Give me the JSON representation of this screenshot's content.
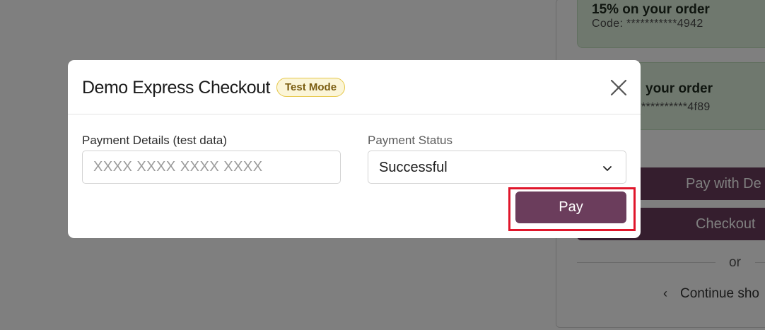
{
  "background": {
    "promo_1": {
      "title": "15% on your order",
      "code": "Code: ***********4942"
    },
    "promo_2": {
      "title": "your order",
      "code": "**********4f89"
    },
    "pay_button_label": "Pay with De",
    "checkout_button_label": "Checkout",
    "divider_text": "or",
    "continue_label": "Continue sho",
    "continue_icon": "chevron-left-icon"
  },
  "modal": {
    "title": "Demo Express Checkout",
    "badge": "Test Mode",
    "close_icon": "close-icon",
    "payment_details": {
      "label": "Payment Details (test data)",
      "placeholder": "XXXX XXXX XXXX XXXX",
      "value": ""
    },
    "payment_status": {
      "label": "Payment Status",
      "selected": "Successful",
      "icon": "chevron-down-icon"
    },
    "pay_button": "Pay"
  },
  "colors": {
    "brand": "#6b3d5c",
    "badge_border": "#e6c84a",
    "badge_bg": "#fbf5d8",
    "highlight": "#e0162b",
    "promo_bg": "#dff1dd"
  }
}
